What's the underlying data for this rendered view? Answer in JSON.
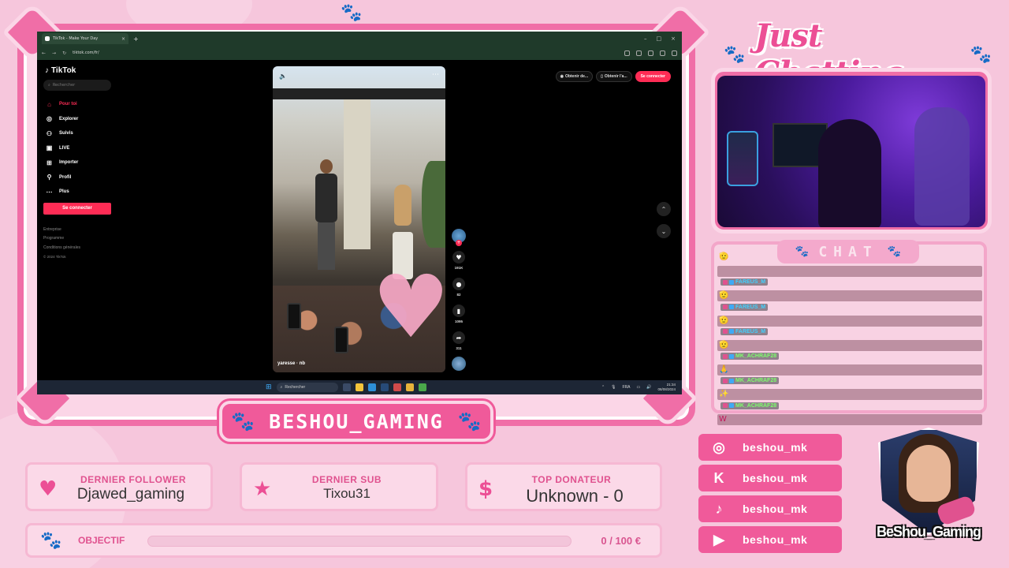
{
  "browser": {
    "tab_title": "TikTok - Make Your Day",
    "url": "tiktok.com/fr/"
  },
  "tiktok": {
    "logo": "TikTok",
    "search_placeholder": "Rechercher",
    "nav": [
      {
        "label": "Pour toi",
        "icon": "home-icon"
      },
      {
        "label": "Explorer",
        "icon": "compass-icon"
      },
      {
        "label": "Suivis",
        "icon": "user-follow-icon"
      },
      {
        "label": "LIVE",
        "icon": "live-icon"
      },
      {
        "label": "Importer",
        "icon": "upload-icon"
      },
      {
        "label": "Profil",
        "icon": "profile-icon"
      },
      {
        "label": "Plus",
        "icon": "more-icon"
      }
    ],
    "login_label": "Se connecter",
    "footer": [
      "Entreprise",
      "Programme",
      "Conditions générales"
    ],
    "copyright": "© 2024 TikTok",
    "top_actions": [
      "Obtenir de...",
      "Obtenir l'a...",
      "Se connecter"
    ],
    "video_caption": "yaresse · nb",
    "counts": {
      "likes": "191K",
      "comments": "82",
      "saves": "1095",
      "shares": "311"
    }
  },
  "taskbar": {
    "search": "Rechercher",
    "lang": "FRA",
    "time": "21:34",
    "date": "08/08/2024"
  },
  "overlay": {
    "streamer_name": "BESHOU_GAMING",
    "category_title": "Just Chatting",
    "chat_title": "CHAT",
    "widgets": {
      "follower": {
        "label": "DERNIER FOLLOWER",
        "value": "Djawed_gaming"
      },
      "sub": {
        "label": "DERNIER SUB",
        "value": "Tixou31"
      },
      "donator": {
        "label": "TOP DONATEUR",
        "value": "Unknown - 0"
      }
    },
    "objective": {
      "label": "OBJECTIF",
      "progress": 0,
      "value": "0 / 100 €"
    },
    "socials": [
      {
        "icon": "instagram-icon",
        "name": "beshou_mk"
      },
      {
        "icon": "kick-icon",
        "name": "beshou_mk"
      },
      {
        "icon": "tiktok-icon",
        "name": "beshou_mk"
      },
      {
        "icon": "youtube-icon",
        "name": "beshou_mk"
      }
    ],
    "logo_text": "BeShou_Gaming"
  },
  "chat": [
    {
      "user": "",
      "color": "#3fd0ff",
      "emote": "🫡"
    },
    {
      "user": "FAREUS_M",
      "color": "#3fd0ff",
      "emote": "🫡"
    },
    {
      "user": "FAREUS_M",
      "color": "#3fd0ff",
      "emote": "🫡"
    },
    {
      "user": "FAREUS_M",
      "color": "#3fd0ff",
      "emote": "🫡"
    },
    {
      "user": "MK_ACHRAF28",
      "color": "#7dff6a",
      "emote": "🙏"
    },
    {
      "user": "MK_ACHRAF28",
      "color": "#7dff6a",
      "emote": "✨"
    },
    {
      "user": "MK_ACHRAF28",
      "color": "#7dff6a",
      "emote": "W"
    }
  ],
  "colors": {
    "accent": "#f05a9a",
    "tiktok_red": "#fe2c55"
  }
}
